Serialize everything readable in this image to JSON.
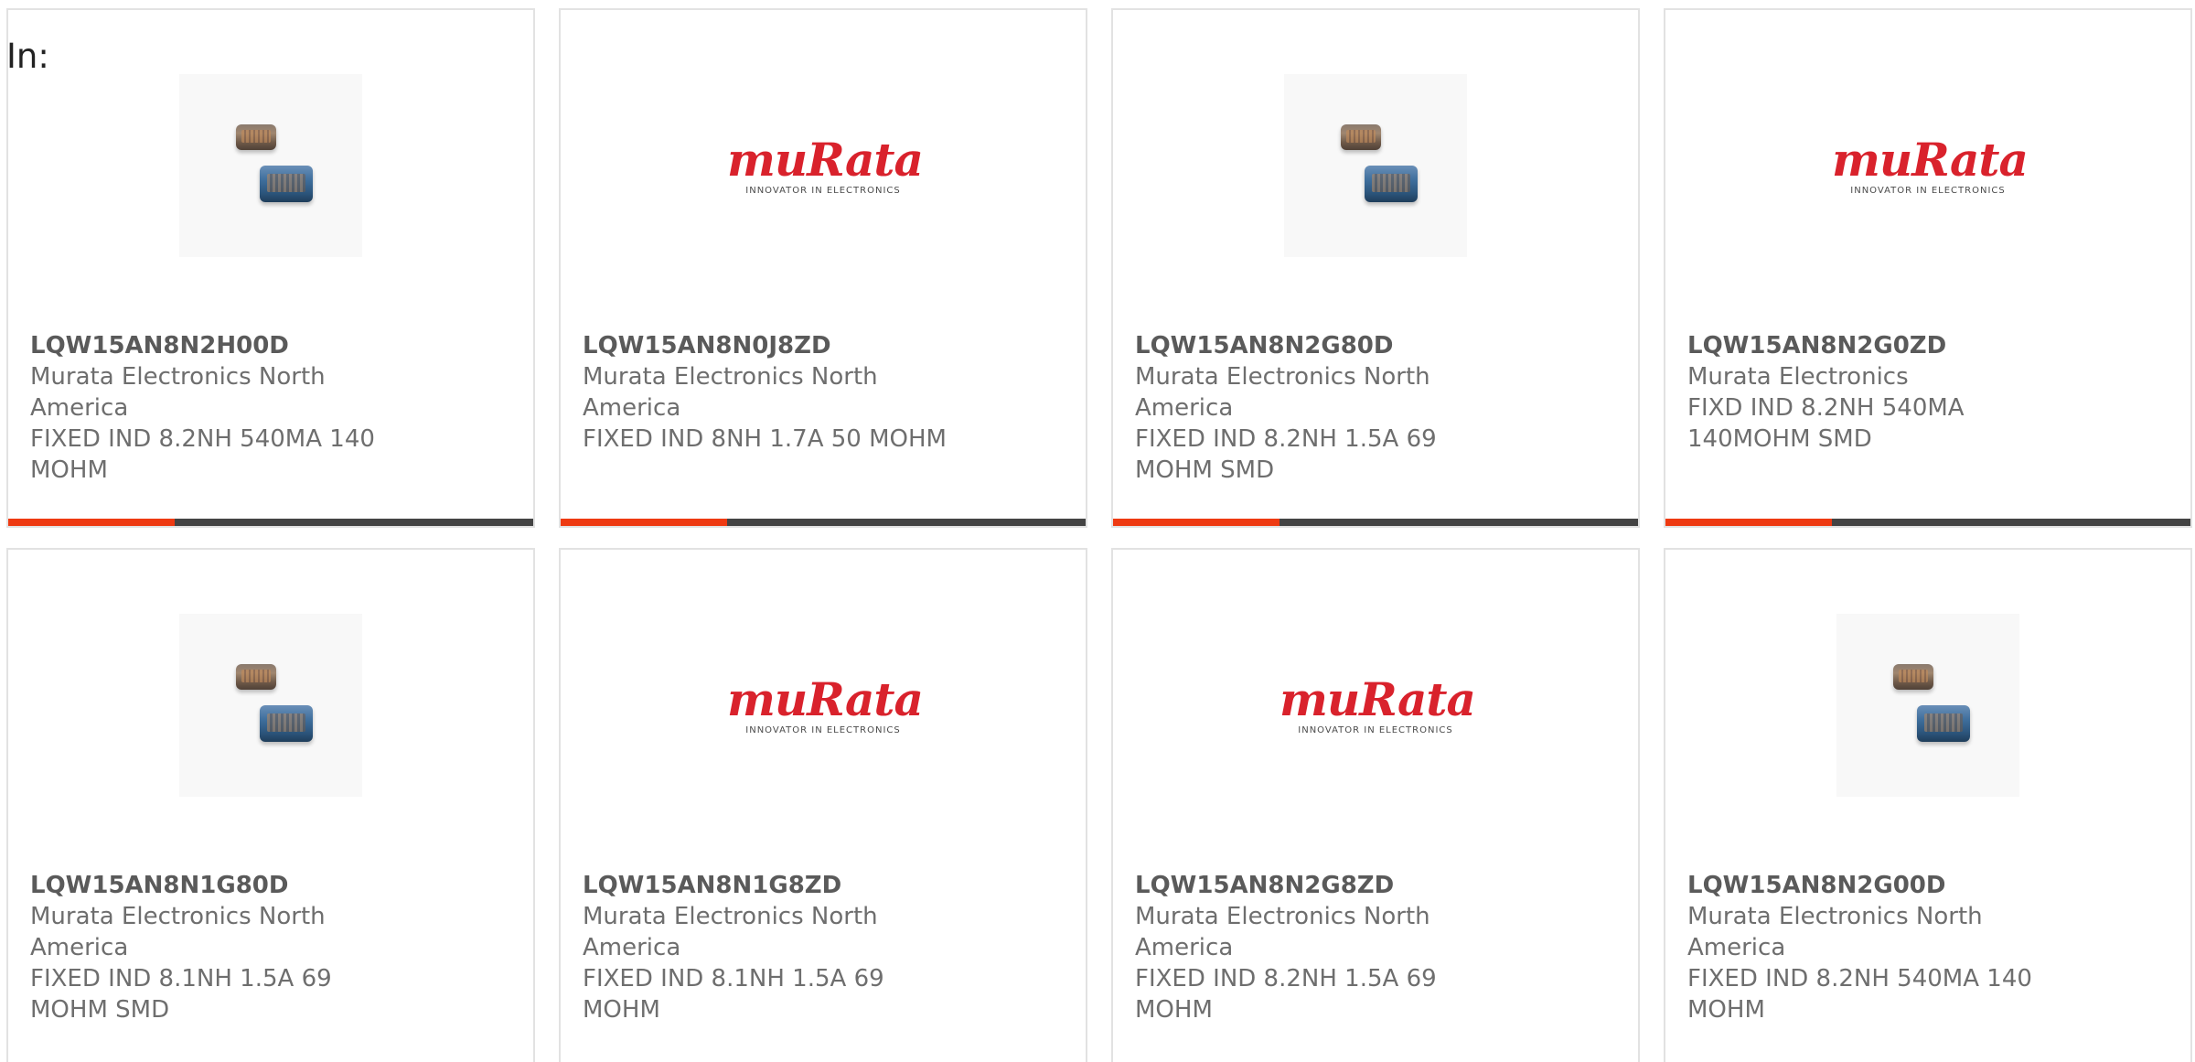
{
  "header": {
    "in_label": "In:"
  },
  "accent_color": "#ee3a12",
  "bar_color": "#444444",
  "products": [
    {
      "part_number": "LQW15AN8N2H00D",
      "manufacturer": "Murata Electronics North America",
      "description": "FIXED IND 8.2NH 540MA 140 MOHM",
      "image": "inductor-chip-photo"
    },
    {
      "part_number": "LQW15AN8N0J8ZD",
      "manufacturer": "Murata Electronics North America",
      "description": "FIXED IND 8NH 1.7A 50 MOHM",
      "image": "murata-logo",
      "logo_text": "muRata",
      "logo_tagline": "INNOVATOR IN ELECTRONICS"
    },
    {
      "part_number": "LQW15AN8N2G80D",
      "manufacturer": "Murata Electronics North America",
      "description": "FIXED IND 8.2NH 1.5A 69 MOHM SMD",
      "image": "inductor-chip-photo"
    },
    {
      "part_number": "LQW15AN8N2G0ZD",
      "manufacturer": "Murata Electronics",
      "description": "FIXD IND 8.2NH 540MA 140MOHM SMD",
      "image": "murata-logo",
      "logo_text": "muRata",
      "logo_tagline": "INNOVATOR IN ELECTRONICS"
    },
    {
      "part_number": "LQW15AN8N1G80D",
      "manufacturer": "Murata Electronics North America",
      "description": "FIXED IND 8.1NH 1.5A 69 MOHM SMD",
      "image": "inductor-chip-photo"
    },
    {
      "part_number": "LQW15AN8N1G8ZD",
      "manufacturer": "Murata Electronics North America",
      "description": "FIXED IND 8.1NH 1.5A 69 MOHM",
      "image": "murata-logo",
      "logo_text": "muRata",
      "logo_tagline": "INNOVATOR IN ELECTRONICS"
    },
    {
      "part_number": "LQW15AN8N2G8ZD",
      "manufacturer": "Murata Electronics North America",
      "description": "FIXED IND 8.2NH 1.5A 69 MOHM",
      "image": "murata-logo",
      "logo_text": "muRata",
      "logo_tagline": "INNOVATOR IN ELECTRONICS"
    },
    {
      "part_number": "LQW15AN8N2G00D",
      "manufacturer": "Murata Electronics North America",
      "description": "FIXED IND 8.2NH 540MA 140 MOHM",
      "image": "inductor-chip-photo"
    }
  ]
}
